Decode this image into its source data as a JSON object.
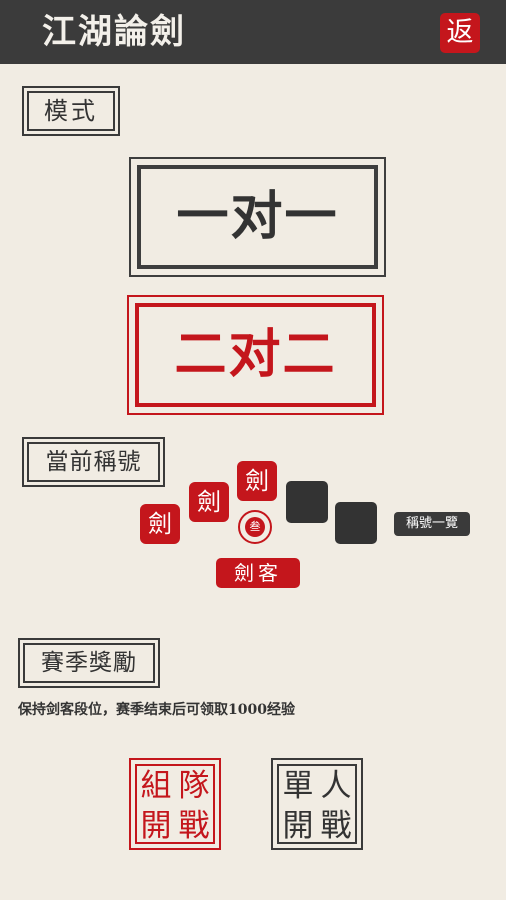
{
  "header": {
    "title": "江湖論劍",
    "back_label": "返"
  },
  "mode_section": {
    "label": "模式",
    "one_vs_one": "一对一",
    "two_vs_two": "二对二"
  },
  "title_section": {
    "label": "當前稱號",
    "seals": [
      "劍",
      "劍",
      "劍"
    ],
    "rank_mark": "叁",
    "current_title": "劍客",
    "title_list_button": "稱號一覽"
  },
  "season_section": {
    "label": "賽季獎勵",
    "description": "保持剑客段位，赛季结束后可领取1000经验"
  },
  "actions": {
    "team_battle": [
      "組",
      "隊",
      "開",
      "戰"
    ],
    "solo_battle": [
      "單",
      "人",
      "開",
      "戰"
    ]
  },
  "colors": {
    "accent": "#c4161c",
    "dark": "#3b3b3b",
    "background": "#f1ece3"
  }
}
